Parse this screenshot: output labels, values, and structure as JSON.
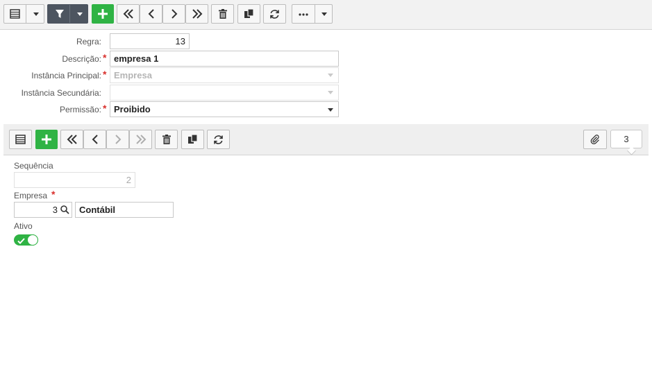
{
  "form": {
    "regra": {
      "label": "Regra:",
      "value": "13"
    },
    "descricao": {
      "label": "Descrição:",
      "value": "empresa 1"
    },
    "instancia_principal": {
      "label": "Instância Principal:",
      "value": "Empresa"
    },
    "instancia_secundaria": {
      "label": "Instância Secundária:",
      "value": ""
    },
    "permissao": {
      "label": "Permissão:",
      "value": "Proibido"
    },
    "required_mark": "*"
  },
  "detail": {
    "counter": "3",
    "sequencia": {
      "label": "Sequência",
      "value": "2"
    },
    "empresa": {
      "label": "Empresa",
      "code": "3",
      "name": "Contábil"
    },
    "ativo": {
      "label": "Ativo",
      "checked": true
    }
  },
  "icons": {
    "grid": "grid-icon",
    "filter": "filter-icon",
    "add": "plus-icon",
    "first": "double-chevron-left-icon",
    "prev": "chevron-left-icon",
    "next": "chevron-right-icon",
    "last": "double-chevron-right-icon",
    "delete": "trash-icon",
    "copy": "copy-icon",
    "refresh": "refresh-icon",
    "more": "ellipsis-icon",
    "attach": "paperclip-icon",
    "search": "search-icon",
    "check": "check-icon"
  },
  "colors": {
    "accent_green": "#2fb344",
    "dark_button": "#4d5560",
    "required": "#d9302c"
  }
}
